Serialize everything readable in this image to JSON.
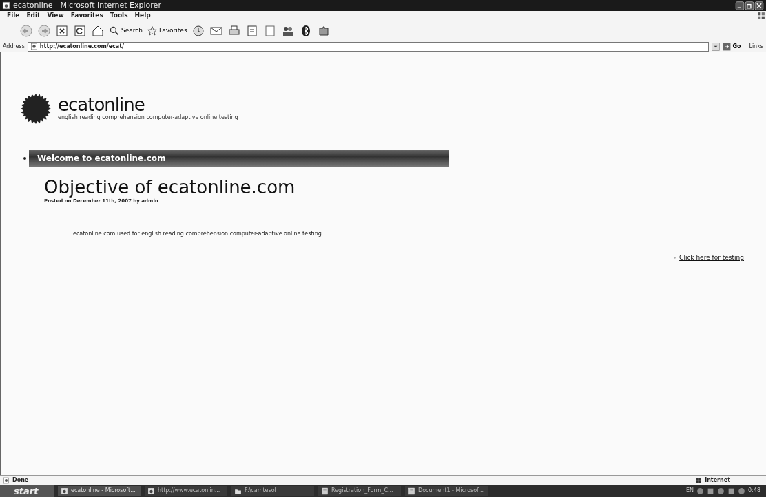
{
  "window": {
    "title": "ecatonline - Microsoft Internet Explorer"
  },
  "menu": [
    "File",
    "Edit",
    "View",
    "Favorites",
    "Tools",
    "Help"
  ],
  "toolbar": [
    "Search",
    "Favorites"
  ],
  "address": {
    "label": "Address",
    "value": "http://ecatonline.com/ecat/",
    "go": "Go",
    "links": "Links"
  },
  "site": {
    "name": "ecatonline",
    "tagline": "english reading comprehension computer-adaptive online testing",
    "nav": [
      "Welcome to ecatonline.com"
    ],
    "post": {
      "title": "Objective of ecatonline.com",
      "meta": "Posted on December 11th, 2007 by admin",
      "body": "ecatonline.com used for english reading comprehension computer-adaptive online testing."
    },
    "side_links": [
      "Click here for testing"
    ]
  },
  "status_bar": {
    "text": "Done",
    "zone": "Internet"
  },
  "taskbar": {
    "start": "start",
    "tasks": [
      {
        "label": "ecatonline - Microsoft...",
        "selected": true
      },
      {
        "label": "http://www.ecatonlin...",
        "selected": false
      },
      {
        "label": "F:\\camtesol",
        "selected": false
      },
      {
        "label": "Registration_Form_C...",
        "selected": false
      },
      {
        "label": "Document1 - Microsof...",
        "selected": false
      }
    ],
    "lang": "EN",
    "clock": "0:48"
  }
}
